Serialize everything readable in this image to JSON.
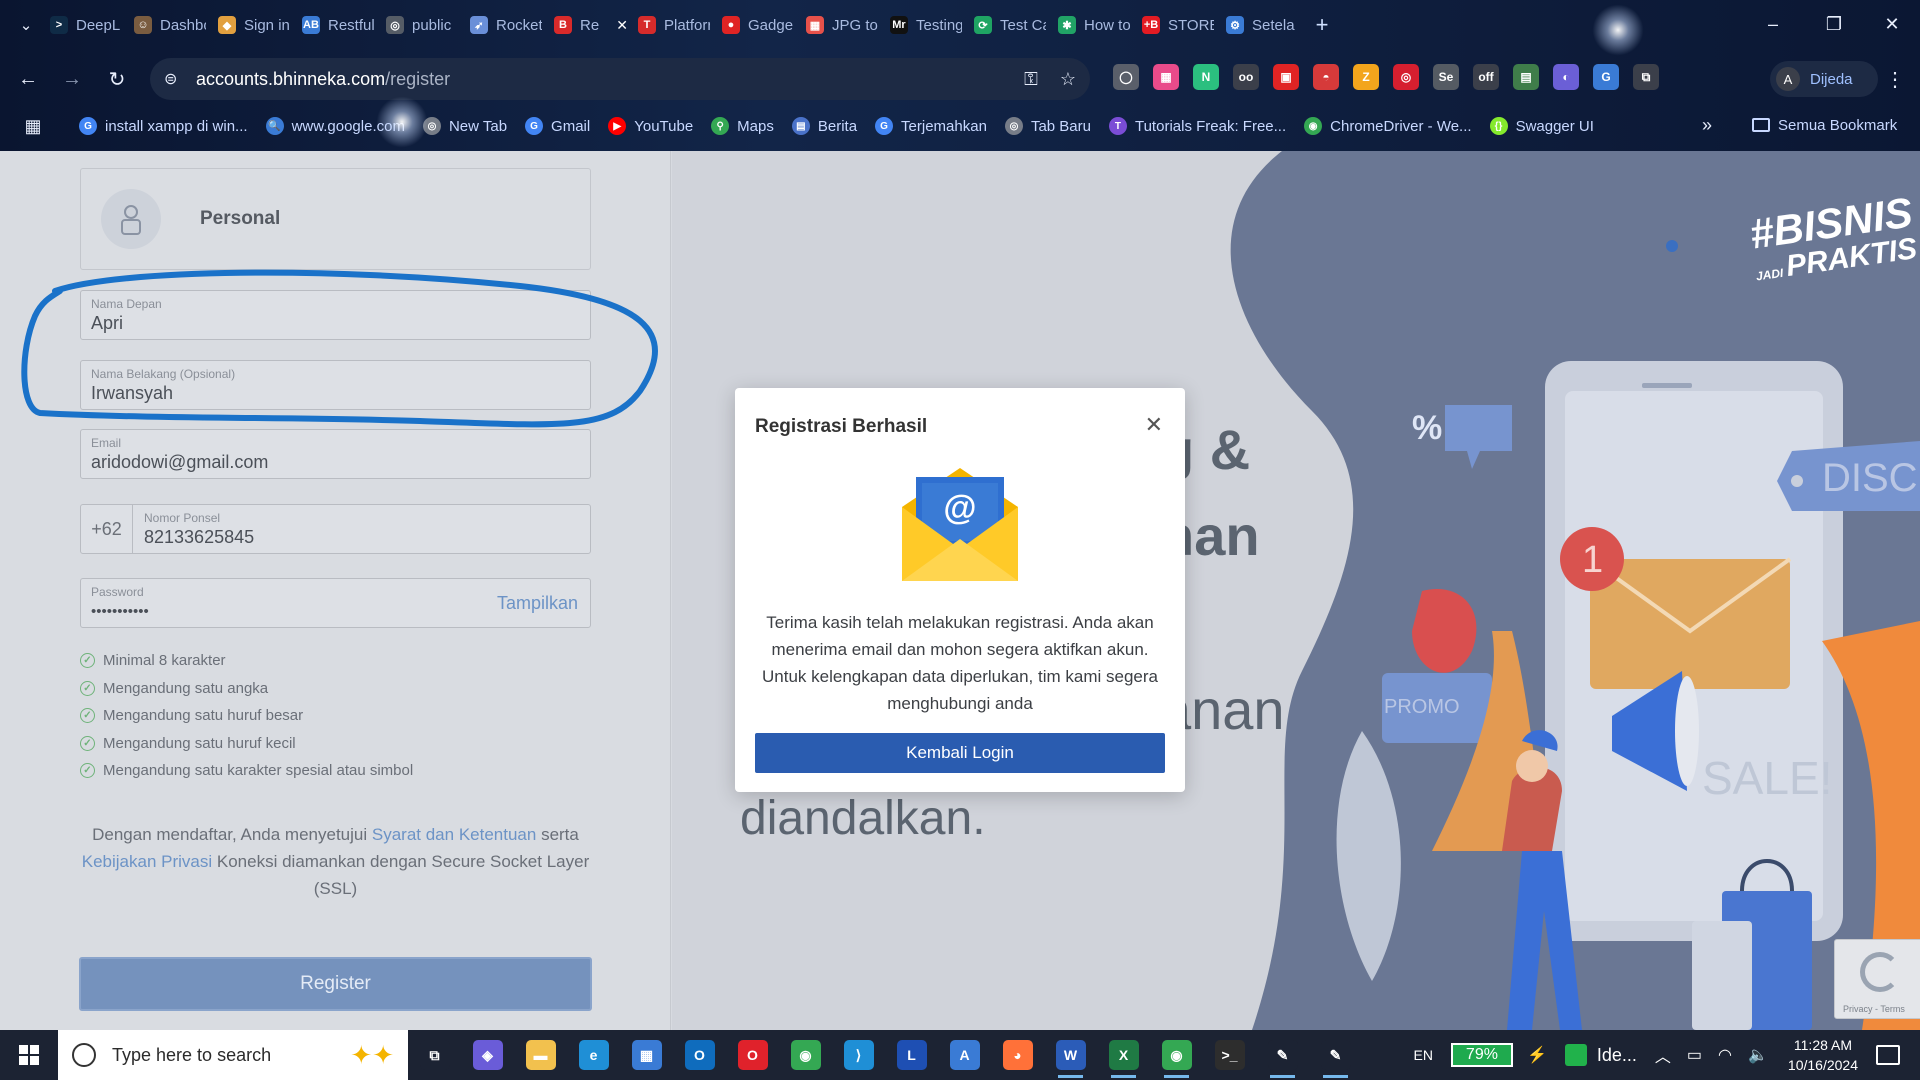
{
  "browser": {
    "tabs": [
      {
        "label": "DeepL",
        "icon_color": "#0f2b46",
        "glyph": ">"
      },
      {
        "label": "Dashbo",
        "icon_color": "#7a5c40",
        "glyph": "☺"
      },
      {
        "label": "Sign in",
        "icon_color": "#e2a03f",
        "glyph": "◆"
      },
      {
        "label": "Restful",
        "icon_color": "#3a7bd5",
        "glyph": "AB"
      },
      {
        "label": "public",
        "icon_color": "#555c66",
        "glyph": "◎"
      },
      {
        "label": "Rocket",
        "icon_color": "#6a8fd8",
        "glyph": "➶"
      },
      {
        "label": "Re",
        "icon_color": "#d92a2a",
        "glyph": "B",
        "close": "✕"
      },
      {
        "label": "Platforr",
        "icon_color": "#d62b2b",
        "glyph": "T"
      },
      {
        "label": "Gadge",
        "icon_color": "#e02424",
        "glyph": "●"
      },
      {
        "label": "JPG to",
        "icon_color": "#e7514a",
        "glyph": "▦"
      },
      {
        "label": "Testing",
        "icon_color": "#111111",
        "glyph": "Mr"
      },
      {
        "label": "Test Ca",
        "icon_color": "#1fa463",
        "glyph": "⟳"
      },
      {
        "label": "How to",
        "icon_color": "#21a366",
        "glyph": "✱"
      },
      {
        "label": "STORE",
        "icon_color": "#e31b23",
        "glyph": "+B"
      },
      {
        "label": "Setela",
        "icon_color": "#3a7bd5",
        "glyph": "⚙"
      }
    ],
    "new_tab": "+",
    "window_controls": {
      "minimize": "–",
      "maximize": "❐",
      "close": "✕"
    },
    "nav": {
      "back": "←",
      "forward": "→",
      "reload": "↻"
    },
    "url_host": "accounts.bhinneka.com",
    "url_path": "/register",
    "omnibox_icons": {
      "site_info": "⊜",
      "password": "⚿",
      "bookmark": "☆"
    },
    "extensions": [
      {
        "name": "ext-circle",
        "color": "#5a5f6a",
        "glyph": "◯"
      },
      {
        "name": "ext-grid",
        "color": "#e94b8a",
        "glyph": "▦"
      },
      {
        "name": "ext-n",
        "color": "#2bbf7f",
        "glyph": "N"
      },
      {
        "name": "ext-glasses",
        "color": "#3b3f4a",
        "glyph": "oo"
      },
      {
        "name": "ext-red",
        "color": "#e02424",
        "glyph": "▣"
      },
      {
        "name": "ext-pokeball",
        "color": "#d63a3a",
        "glyph": "◓"
      },
      {
        "name": "ext-z",
        "color": "#f3a51c",
        "glyph": "Z"
      },
      {
        "name": "ext-target",
        "color": "#d61f2f",
        "glyph": "◎"
      },
      {
        "name": "ext-se",
        "color": "#555b63",
        "glyph": "Se"
      },
      {
        "name": "ext-off",
        "color": "#3b3f4a",
        "glyph": "off"
      },
      {
        "name": "ext-sheet",
        "color": "#3f7d4a",
        "glyph": "▤"
      },
      {
        "name": "ext-game",
        "color": "#6b5fd6",
        "glyph": "◐"
      },
      {
        "name": "ext-translate",
        "color": "#3a7bd5",
        "glyph": "G"
      },
      {
        "name": "ext-puzzle",
        "color": "#3b3f4a",
        "glyph": "⧉"
      }
    ],
    "profile": {
      "initial": "A",
      "label": "Dijeda"
    },
    "menu": "⋮",
    "bookmarks": [
      {
        "label": "install xampp di win...",
        "icon_color": "#4285f4",
        "glyph": "G"
      },
      {
        "label": "www.google.com",
        "icon_color": "#3a7bd5",
        "glyph": "🔍"
      },
      {
        "label": "New Tab",
        "icon_color": "#777d88",
        "glyph": "◎"
      },
      {
        "label": "Gmail",
        "icon_color": "#4285f4",
        "glyph": "G"
      },
      {
        "label": "YouTube",
        "icon_color": "#ff0000",
        "glyph": "▶"
      },
      {
        "label": "Maps",
        "icon_color": "#34a853",
        "glyph": "⚲"
      },
      {
        "label": "Berita",
        "icon_color": "#4a72c9",
        "glyph": "▤"
      },
      {
        "label": "Terjemahkan",
        "icon_color": "#4285f4",
        "glyph": "G"
      },
      {
        "label": "Tab Baru",
        "icon_color": "#777d88",
        "glyph": "◎"
      },
      {
        "label": "Tutorials Freak: Free...",
        "icon_color": "#7b4dd6",
        "glyph": "T"
      },
      {
        "label": "ChromeDriver - We...",
        "icon_color": "#34a853",
        "glyph": "◉"
      },
      {
        "label": "Swagger UI",
        "icon_color": "#85ea2d",
        "glyph": "{}"
      }
    ],
    "bookmarks_more": "»",
    "all_bookmarks": "Semua Bookmark"
  },
  "form": {
    "section_title": "Personal",
    "first_name": {
      "label": "Nama Depan",
      "value": "Apri"
    },
    "last_name": {
      "label": "Nama Belakang (Opsional)",
      "value": "Irwansyah"
    },
    "email": {
      "label": "Email",
      "value": "aridodowi@gmail.com"
    },
    "phone": {
      "prefix": "+62",
      "label": "Nomor Ponsel",
      "value": "82133625845"
    },
    "password": {
      "label": "Password",
      "value": "•••••••••••",
      "show_label": "Tampilkan"
    },
    "rules": [
      "Minimal 8 karakter",
      "Mengandung satu angka",
      "Mengandung satu huruf besar",
      "Mengandung satu huruf kecil",
      "Mengandung satu karakter spesial atau simbol"
    ],
    "terms": {
      "prefix": "Dengan mendaftar, Anda menyetujui ",
      "link1": "Syarat dan Ketentuan",
      "middle": " serta ",
      "link2": "Kebijakan Privasi",
      "suffix": " Koneksi diamankan dengan Secure Socket Layer (SSL)"
    },
    "register_label": "Register"
  },
  "hero": {
    "line1": "g &",
    "line2": "han",
    "line3": "anan",
    "line4": "diandalkan.",
    "brand_line1": "#BISNIS",
    "brand_jadi": "JADI",
    "brand_line2": "PRAKTIS",
    "tag_percent": "%",
    "tag_disc": "DISC.",
    "tag_promo": "PROMO",
    "tag_sale": "SALE!",
    "badge_number": "1",
    "recaptcha_links": "Privacy - Terms"
  },
  "modal": {
    "title": "Registrasi Berhasil",
    "close": "✕",
    "icon": "email-envelope-icon",
    "envelope_at": "@",
    "body": "Terima kasih telah melakukan registrasi. Anda akan menerima email dan mohon segera aktifkan akun. Untuk kelengkapan data diperlukan, tim kami segera menghubungi anda",
    "button_label": "Kembali Login"
  },
  "taskbar": {
    "search_placeholder": "Type here to search",
    "apps": [
      {
        "name": "task-view",
        "color": "#1c2333",
        "glyph": "⧉",
        "active": false
      },
      {
        "name": "copilot",
        "color": "#6a5cd8",
        "glyph": "◈",
        "active": false
      },
      {
        "name": "file-explorer",
        "color": "#f2c14e",
        "glyph": "▬",
        "active": false
      },
      {
        "name": "edge",
        "color": "#1f8fd6",
        "glyph": "e",
        "active": false
      },
      {
        "name": "store",
        "color": "#3a7bd5",
        "glyph": "▦",
        "active": false
      },
      {
        "name": "outlook",
        "color": "#0f6cbd",
        "glyph": "O",
        "active": false
      },
      {
        "name": "opera",
        "color": "#e0222b",
        "glyph": "O",
        "active": false
      },
      {
        "name": "chrome",
        "color": "#34a853",
        "glyph": "◉",
        "active": false
      },
      {
        "name": "vscode",
        "color": "#1f8fd6",
        "glyph": "⟩",
        "active": false
      },
      {
        "name": "l-app",
        "color": "#1e4fb3",
        "glyph": "L",
        "active": false
      },
      {
        "name": "a-app",
        "color": "#3a7bd5",
        "glyph": "A",
        "active": false
      },
      {
        "name": "firefox",
        "color": "#ff7139",
        "glyph": "◕",
        "active": false
      },
      {
        "name": "word",
        "color": "#2b5cb8",
        "glyph": "W",
        "active": true
      },
      {
        "name": "excel",
        "color": "#1f7a44",
        "glyph": "X",
        "active": true
      },
      {
        "name": "chrome-profile",
        "color": "#34a853",
        "glyph": "◉",
        "active": true
      },
      {
        "name": "terminal",
        "color": "#2d2d2d",
        "glyph": ">_",
        "active": false
      },
      {
        "name": "pen-app-1",
        "color": "#1c2333",
        "glyph": "✎",
        "active": true
      },
      {
        "name": "pen-app-2",
        "color": "#1c2333",
        "glyph": "✎",
        "active": true
      }
    ],
    "language": "EN",
    "battery": "79%",
    "tray_app_label": "Ide...",
    "time": "11:28 AM",
    "date": "10/16/2024"
  }
}
